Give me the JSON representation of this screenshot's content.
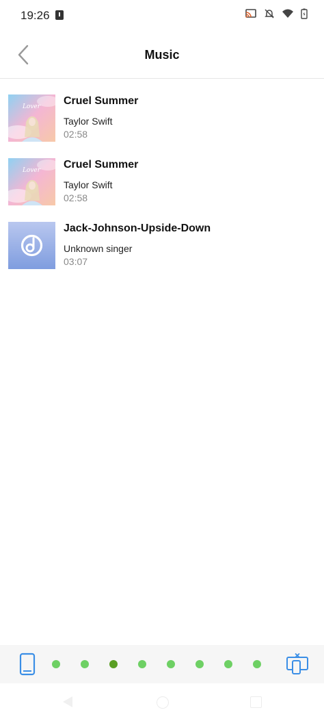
{
  "status_bar": {
    "time": "19:26"
  },
  "header": {
    "title": "Music"
  },
  "tracks": [
    {
      "title": "Cruel Summer",
      "artist": "Taylor Swift",
      "duration": "02:58",
      "art": "lover-album-art",
      "art_script": "Lover"
    },
    {
      "title": "Cruel Summer",
      "artist": "Taylor Swift",
      "duration": "02:58",
      "art": "lover-album-art",
      "art_script": "Lover"
    },
    {
      "title": "Jack-Johnson-Upside-Down",
      "artist": "Unknown singer",
      "duration": "03:07",
      "art": "music-note-icon"
    }
  ],
  "device_bar": {
    "page_count": 8,
    "active_page": 3
  },
  "colors": {
    "accent_blue": "#3a8ee6",
    "dot_green": "#6ed064",
    "dot_active": "#5a9e24",
    "divider": "#e6e6e6",
    "placeholder_gradient_top": "#b9c7ef",
    "placeholder_gradient_bottom": "#7f9ddf"
  }
}
